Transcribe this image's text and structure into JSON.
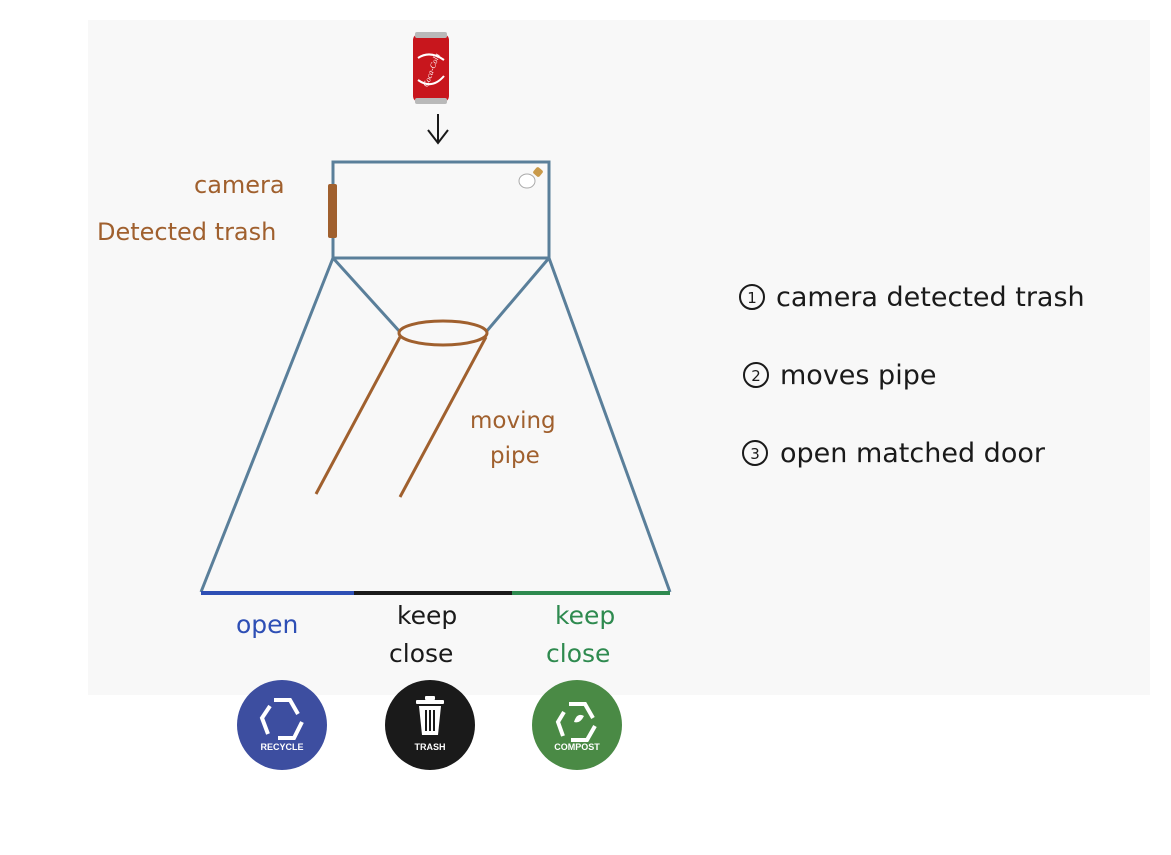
{
  "labels": {
    "camera": "camera",
    "detected_trash": "Detected trash",
    "moving": "moving",
    "pipe": "pipe",
    "door_left": "open",
    "door_mid_1": "keep",
    "door_mid_2": "close",
    "door_right_1": "keep",
    "door_right_2": "close"
  },
  "steps": {
    "step1_num": "1",
    "step1": "camera detected trash",
    "step2_num": "2",
    "step2": "moves pipe",
    "step3_num": "3",
    "step3": "open matched door"
  },
  "badges": {
    "recycle": "RECYCLE",
    "trash": "TRASH",
    "compost": "COMPOST"
  },
  "can": {
    "brand": "Coca-Cola"
  },
  "colors": {
    "frame": "#5a7f9a",
    "annotation": "#a0602e",
    "recycle": "#3d4ea0",
    "trash": "#1a1a1a",
    "compost": "#4a8a45",
    "door_open": "#2e4fb5",
    "door_closed": "#1a1a1a",
    "door_compost": "#2e8a4f"
  }
}
